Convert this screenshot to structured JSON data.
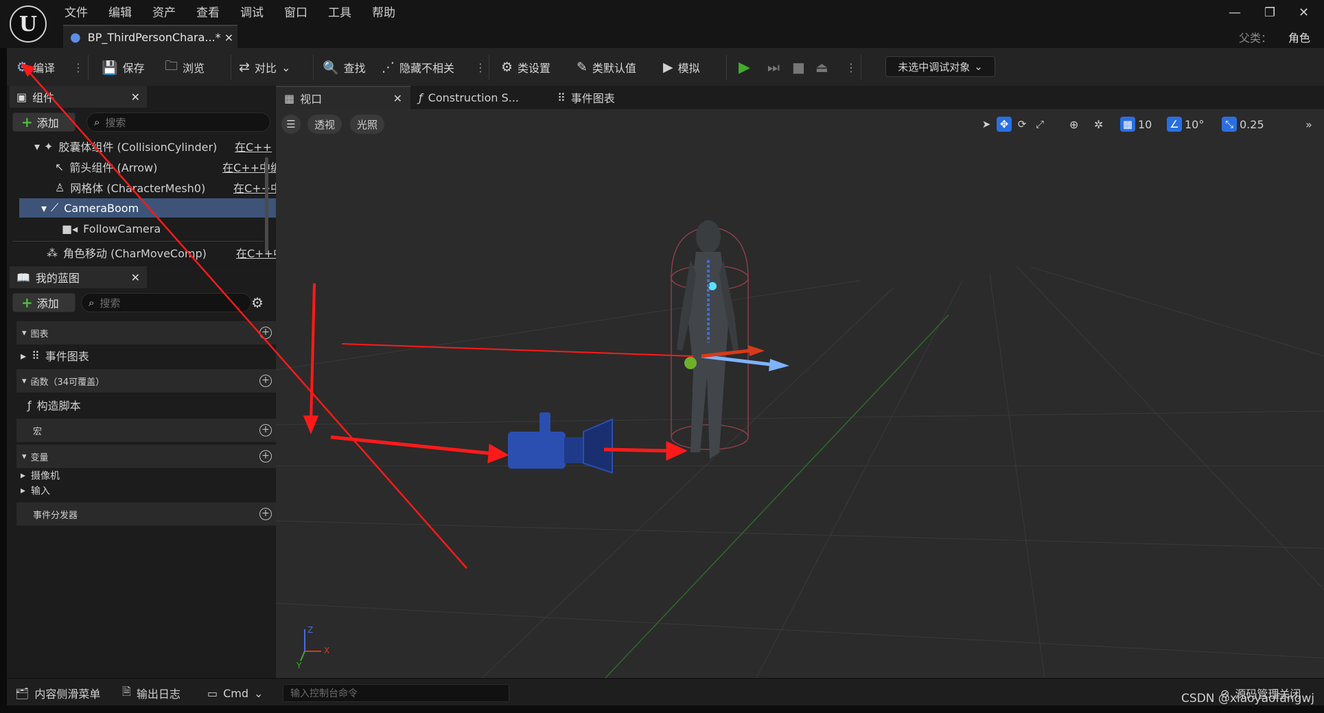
{
  "window": {
    "menu": [
      "文件",
      "编辑",
      "资产",
      "查看",
      "调试",
      "窗口",
      "工具",
      "帮助"
    ],
    "doc_tab": "BP_ThirdPersonChara...* ×",
    "parent_label": "父类：",
    "parent_value": "角色",
    "logo_text": "U"
  },
  "toolbar": {
    "compile": "编译",
    "save": "保存",
    "browse": "浏览",
    "diff": "对比",
    "find": "查找",
    "hide_unrelated": "隐藏不相关",
    "class_settings": "类设置",
    "class_defaults": "类默认值",
    "simulate": "模拟",
    "debug_object": "未选中调试对象"
  },
  "components_panel": {
    "tab": "组件",
    "add": "添加",
    "search_placeholder": "搜索",
    "tree": [
      {
        "label": "胶囊体组件 (CollisionCylinder)",
        "link": "在C++"
      },
      {
        "label": "箭头组件 (Arrow)",
        "link": "在C++中编辑"
      },
      {
        "label": "网格体 (CharacterMesh0)",
        "link": "在C++中编"
      },
      {
        "label": "CameraBoom",
        "link": ""
      },
      {
        "label": "FollowCamera",
        "link": ""
      },
      {
        "label": "角色移动 (CharMoveComp)",
        "link": "在C++中"
      }
    ]
  },
  "blueprint_panel": {
    "tab": "我的蓝图",
    "add": "添加",
    "search_placeholder": "搜索",
    "sections": {
      "graphs": "图表",
      "event_graph": "事件图表",
      "functions": "函数（34可覆盖）",
      "construction_script": "构造脚本",
      "macros": "宏",
      "variables": "变量",
      "var_camera": "摄像机",
      "var_input": "输入",
      "event_dispatchers": "事件分发器"
    }
  },
  "viewport_tabs": [
    "视口",
    "Construction S...",
    "事件图表"
  ],
  "viewport": {
    "perspective": "透视",
    "lighting": "光照",
    "grid_size": "10",
    "rotation_snap": "10°",
    "scale_snap": "0.25",
    "axis_x": "X",
    "axis_y": "Y",
    "axis_z": "Z"
  },
  "bottombar": {
    "content_drawer": "内容侧滑菜单",
    "output_log": "输出日志",
    "cmd": "Cmd",
    "console_placeholder": "输入控制台命令",
    "source_control": "源码管理关闭"
  },
  "watermark": "CSDN @xiaoyaofangwj",
  "colors": {
    "accent_blue": "#2a6fe0",
    "play_green": "#3fae2a",
    "annotation_red": "#ff1a1a",
    "selected_row": "#3d5478"
  }
}
